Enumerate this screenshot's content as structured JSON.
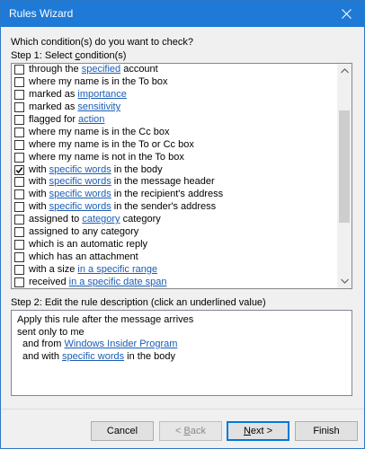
{
  "window": {
    "title": "Rules Wizard"
  },
  "question": "Which condition(s) do you want to check?",
  "step1": {
    "prefix": "Step 1: Select ",
    "underlined": "c",
    "suffix": "ondition(s)"
  },
  "conditions": [
    {
      "checked": false,
      "parts": [
        {
          "t": "through the "
        },
        {
          "t": "specified",
          "link": true
        },
        {
          "t": " account"
        }
      ]
    },
    {
      "checked": false,
      "parts": [
        {
          "t": "where my name is in the To box"
        }
      ]
    },
    {
      "checked": false,
      "parts": [
        {
          "t": "marked as "
        },
        {
          "t": "importance",
          "link": true
        }
      ]
    },
    {
      "checked": false,
      "parts": [
        {
          "t": "marked as "
        },
        {
          "t": "sensitivity",
          "link": true
        }
      ]
    },
    {
      "checked": false,
      "parts": [
        {
          "t": "flagged for "
        },
        {
          "t": "action",
          "link": true
        }
      ]
    },
    {
      "checked": false,
      "parts": [
        {
          "t": "where my name is in the Cc box"
        }
      ]
    },
    {
      "checked": false,
      "parts": [
        {
          "t": "where my name is in the To or Cc box"
        }
      ]
    },
    {
      "checked": false,
      "parts": [
        {
          "t": "where my name is not in the To box"
        }
      ]
    },
    {
      "checked": true,
      "parts": [
        {
          "t": "with "
        },
        {
          "t": "specific words",
          "link": true
        },
        {
          "t": " in the body"
        }
      ]
    },
    {
      "checked": false,
      "parts": [
        {
          "t": "with "
        },
        {
          "t": "specific words",
          "link": true
        },
        {
          "t": " in the message header"
        }
      ]
    },
    {
      "checked": false,
      "parts": [
        {
          "t": "with "
        },
        {
          "t": "specific words",
          "link": true
        },
        {
          "t": " in the recipient's address"
        }
      ]
    },
    {
      "checked": false,
      "parts": [
        {
          "t": "with "
        },
        {
          "t": "specific words",
          "link": true
        },
        {
          "t": " in the sender's address"
        }
      ]
    },
    {
      "checked": false,
      "parts": [
        {
          "t": "assigned to "
        },
        {
          "t": "category",
          "link": true
        },
        {
          "t": " category"
        }
      ]
    },
    {
      "checked": false,
      "parts": [
        {
          "t": "assigned to any category"
        }
      ]
    },
    {
      "checked": false,
      "parts": [
        {
          "t": "which is an automatic reply"
        }
      ]
    },
    {
      "checked": false,
      "parts": [
        {
          "t": "which has an attachment"
        }
      ]
    },
    {
      "checked": false,
      "parts": [
        {
          "t": "with a size "
        },
        {
          "t": "in a specific range",
          "link": true
        }
      ]
    },
    {
      "checked": false,
      "parts": [
        {
          "t": "received "
        },
        {
          "t": "in a specific date span",
          "link": true
        }
      ]
    }
  ],
  "step2": "Step 2: Edit the rule description (click an underlined value)",
  "description": [
    {
      "indent": 0,
      "parts": [
        {
          "t": "Apply this rule after the message arrives"
        }
      ]
    },
    {
      "indent": 0,
      "parts": [
        {
          "t": "sent only to me"
        }
      ]
    },
    {
      "indent": 1,
      "parts": [
        {
          "t": "and from "
        },
        {
          "t": "Windows Insider Program",
          "link": true
        }
      ]
    },
    {
      "indent": 1,
      "parts": [
        {
          "t": "and with "
        },
        {
          "t": "specific words",
          "link": true
        },
        {
          "t": " in the body"
        }
      ]
    }
  ],
  "buttons": {
    "cancel": "Cancel",
    "back": "< Back",
    "back_underline": "B",
    "next": "Next >",
    "next_underline": "N",
    "finish": "Finish"
  },
  "colors": {
    "titlebar": "#1e7ad6",
    "link": "#1a5cb6",
    "default_button_border": "#0078d7"
  },
  "icons": {
    "close": "close-icon",
    "check": "checkmark-icon",
    "scroll_up": "chevron-up-icon",
    "scroll_down": "chevron-down-icon"
  }
}
